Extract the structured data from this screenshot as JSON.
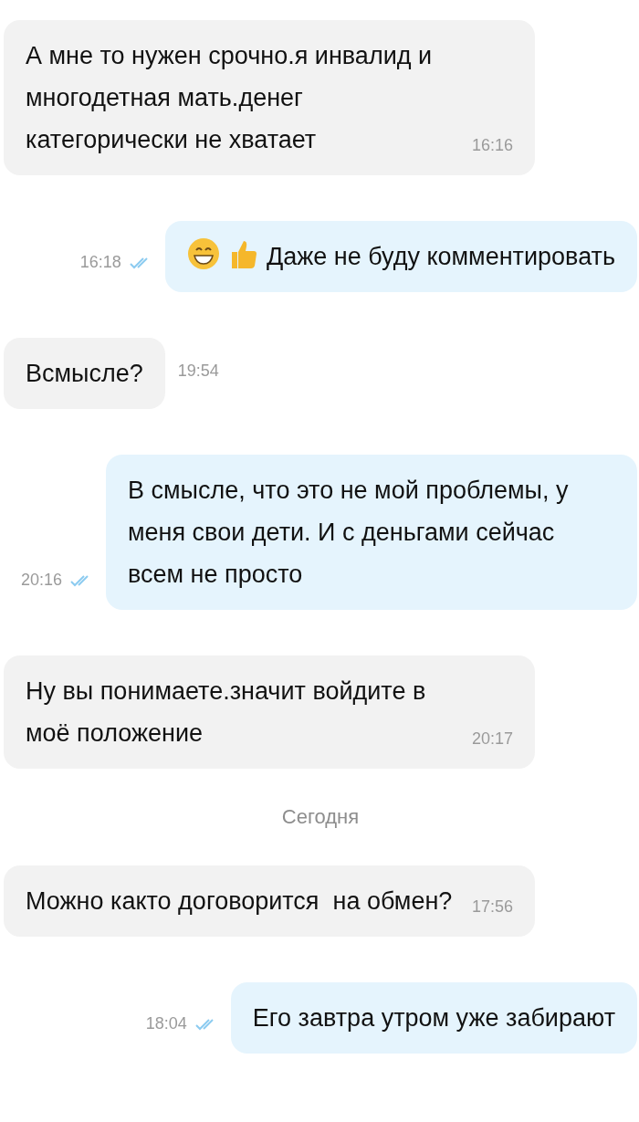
{
  "messages": [
    {
      "kind": "in",
      "text": "А мне то нужен срочно.я инвалид и многодетная мать.денег категорически не хватает",
      "time": "16:16",
      "time_outside": false,
      "leading_emoji": false
    },
    {
      "kind": "out",
      "text": "Даже не буду комментировать",
      "time": "16:18",
      "read": true,
      "leading_emoji": true
    },
    {
      "kind": "in",
      "text": "Всмысле?",
      "time": "19:54",
      "time_outside": true,
      "leading_emoji": false
    },
    {
      "kind": "out",
      "text": "В смысле, что это не мой проблемы, у меня свои дети. И с деньгами сейчас всем не просто",
      "time": "20:16",
      "read": true,
      "leading_emoji": false
    },
    {
      "kind": "in",
      "text": "Ну вы понимаете.значит войдите в моё положение",
      "time": "20:17",
      "time_outside": false,
      "leading_emoji": false
    },
    {
      "kind": "date",
      "text": "Сегодня"
    },
    {
      "kind": "in",
      "text": "Можно както договорится  на обмен?",
      "time": "17:56",
      "time_outside": false,
      "leading_emoji": false
    },
    {
      "kind": "out",
      "text": "Его завтра утром уже забирают",
      "time": "18:04",
      "read": true,
      "leading_emoji": false
    }
  ]
}
